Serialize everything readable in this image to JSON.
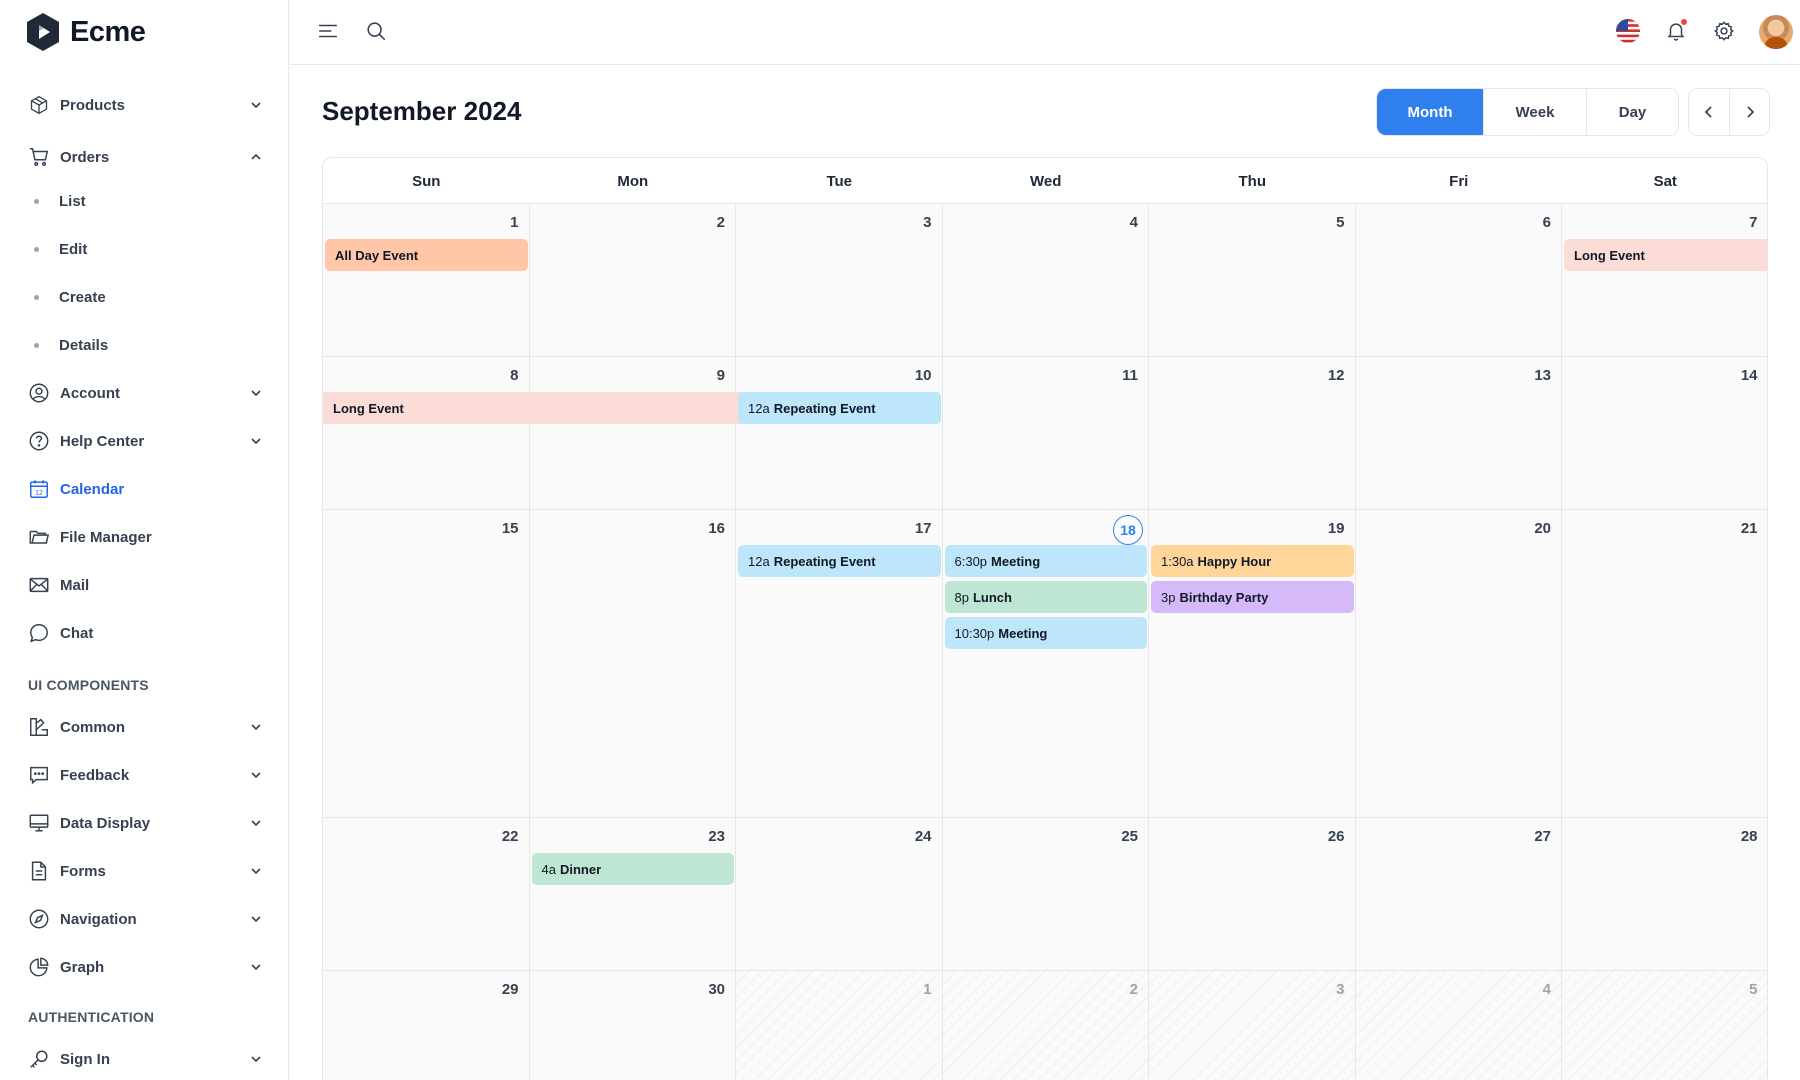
{
  "brand": {
    "name": "Ecme"
  },
  "sidebar": {
    "items": [
      {
        "label": "Products",
        "icon": "box-icon",
        "expanded": false
      },
      {
        "label": "Orders",
        "icon": "cart-icon",
        "expanded": true,
        "children": [
          "List",
          "Edit",
          "Create",
          "Details"
        ]
      },
      {
        "label": "Account",
        "icon": "user-circle-icon",
        "expanded": false
      },
      {
        "label": "Help Center",
        "icon": "help-circle-icon",
        "expanded": false
      },
      {
        "label": "Calendar",
        "icon": "calendar-icon",
        "active": true
      },
      {
        "label": "File Manager",
        "icon": "folder-icon"
      },
      {
        "label": "Mail",
        "icon": "mail-icon"
      },
      {
        "label": "Chat",
        "icon": "chat-icon"
      }
    ],
    "section_ui": "UI COMPONENTS",
    "ui_items": [
      {
        "label": "Common",
        "icon": "shapes-icon"
      },
      {
        "label": "Feedback",
        "icon": "message-square-icon"
      },
      {
        "label": "Data Display",
        "icon": "monitor-icon"
      },
      {
        "label": "Forms",
        "icon": "file-text-icon"
      },
      {
        "label": "Navigation",
        "icon": "compass-icon"
      },
      {
        "label": "Graph",
        "icon": "pie-chart-icon"
      }
    ],
    "section_auth": "AUTHENTICATION",
    "auth_items": [
      {
        "label": "Sign In",
        "icon": "key-icon"
      }
    ]
  },
  "header": {
    "icons": [
      "menu-icon",
      "search-icon",
      "us-flag-icon",
      "bell-icon",
      "gear-icon",
      "avatar"
    ]
  },
  "calendar": {
    "title": "September 2024",
    "views": [
      "Month",
      "Week",
      "Day"
    ],
    "active_view": "Month",
    "weekdays": [
      "Sun",
      "Mon",
      "Tue",
      "Wed",
      "Thu",
      "Fri",
      "Sat"
    ],
    "weeks": [
      [
        "1",
        "2",
        "3",
        "4",
        "5",
        "6",
        "7"
      ],
      [
        "8",
        "9",
        "10",
        "11",
        "12",
        "13",
        "14"
      ],
      [
        "15",
        "16",
        "17",
        "18",
        "19",
        "20",
        "21"
      ],
      [
        "22",
        "23",
        "24",
        "25",
        "26",
        "27",
        "28"
      ],
      [
        "29",
        "30",
        "1",
        "2",
        "3",
        "4",
        "5"
      ]
    ],
    "today": "18",
    "events": [
      {
        "title": "All Day Event",
        "time": "",
        "color": "#ffc7a8",
        "start_date": "2024-09-01",
        "end_date": "2024-09-01"
      },
      {
        "title": "Long Event",
        "time": "",
        "color": "#fcdcd6",
        "start_date": "2024-09-07",
        "end_date": "2024-09-10"
      },
      {
        "title": "Repeating Event",
        "time": "12a",
        "color": "#bde6fa",
        "start_date": "2024-09-10"
      },
      {
        "title": "Repeating Event",
        "time": "12a",
        "color": "#bde6fa",
        "start_date": "2024-09-17"
      },
      {
        "title": "Meeting",
        "time": "6:30p",
        "color": "#bde6fa",
        "start_date": "2024-09-18"
      },
      {
        "title": "Lunch",
        "time": "8p",
        "color": "#bfe6d2",
        "start_date": "2024-09-18"
      },
      {
        "title": "Meeting",
        "time": "10:30p",
        "color": "#bde6fa",
        "start_date": "2024-09-18"
      },
      {
        "title": "Happy Hour",
        "time": "1:30a",
        "color": "#ffd59a",
        "start_date": "2024-09-19"
      },
      {
        "title": "Birthday Party",
        "time": "3p",
        "color": "#d5b9f8",
        "start_date": "2024-09-19"
      },
      {
        "title": "Dinner",
        "time": "4a",
        "color": "#bfe6d2",
        "start_date": "2024-09-23"
      }
    ]
  }
}
